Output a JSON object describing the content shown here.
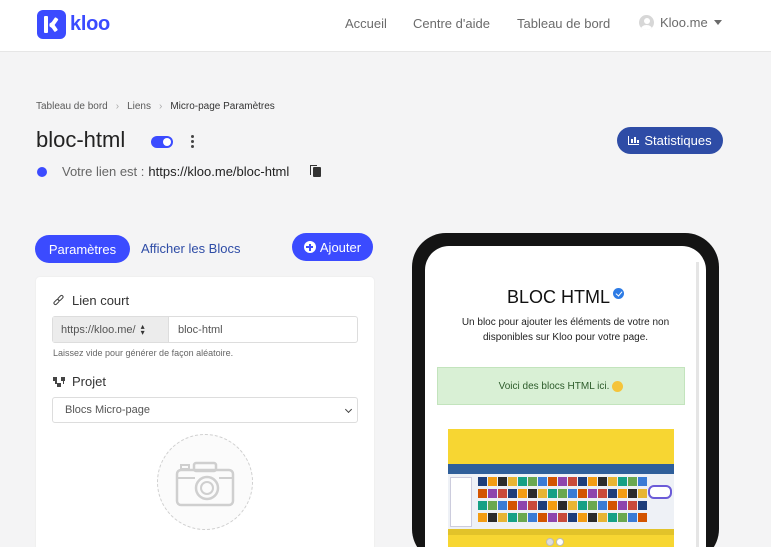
{
  "brand": {
    "name": "kloo",
    "accent": "#3b4bff",
    "dark_accent": "#2e4ca6"
  },
  "nav": {
    "items": [
      "Accueil",
      "Centre d'aide",
      "Tableau de bord"
    ],
    "user": "Kloo.me"
  },
  "breadcrumb": [
    "Tableau de bord",
    "Liens",
    "Micro-page Paramètres"
  ],
  "page": {
    "title": "bloc-html",
    "enabled": true,
    "link_prefix": "Votre lien est :",
    "link_url": "https://kloo.me/bloc-html",
    "stats_label": "Statistiques"
  },
  "tabs": {
    "active": "Paramètres",
    "other": "Afficher les Blocs",
    "add_label": "Ajouter"
  },
  "form": {
    "short_link": {
      "label": "Lien court",
      "domain": "https://kloo.me/",
      "value": "bloc-html",
      "help": "Laissez vide pour générer de façon aléatoire."
    },
    "project": {
      "label": "Projet",
      "selected": "Blocs Micro-page"
    }
  },
  "preview": {
    "title": "BLOC HTML",
    "description": "Un bloc pour ajouter les éléments de votre non disponibles sur Kloo pour votre page.",
    "alert": "Voici des blocs HTML ici."
  },
  "icons": [
    "link-icon",
    "project-icon",
    "camera-icon",
    "chart-icon",
    "copy-icon",
    "plus-icon",
    "verified-icon",
    "kebab-icon",
    "user-icon"
  ]
}
